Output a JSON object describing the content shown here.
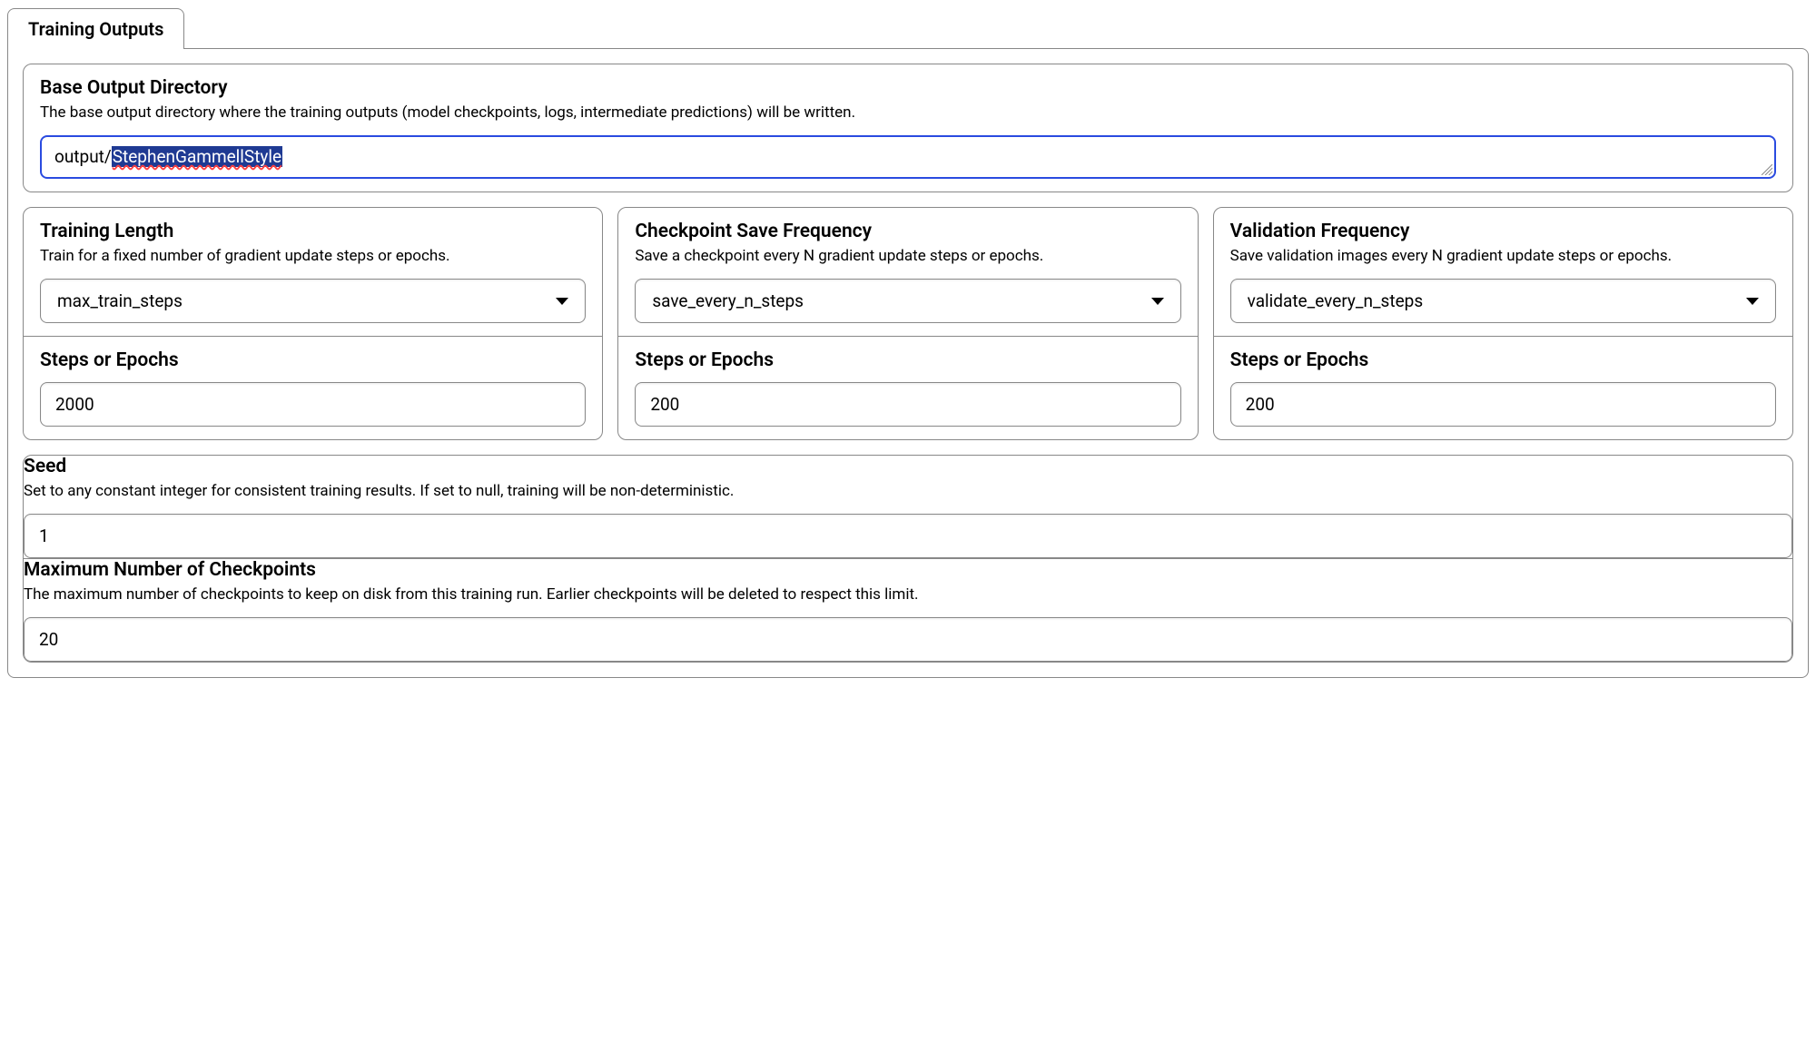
{
  "tab": {
    "label": "Training Outputs"
  },
  "base_output": {
    "title": "Base Output Directory",
    "desc": "The base output directory where the training outputs (model checkpoints, logs, intermediate predictions) will be written.",
    "value_prefix": "output/",
    "value_selected": "StephenGammellStyle"
  },
  "training_length": {
    "title": "Training Length",
    "desc": "Train for a fixed number of gradient update steps or epochs.",
    "select_value": "max_train_steps",
    "steps_label": "Steps or Epochs",
    "steps_value": "2000"
  },
  "checkpoint_freq": {
    "title": "Checkpoint Save Frequency",
    "desc": "Save a checkpoint every N gradient update steps or epochs.",
    "select_value": "save_every_n_steps",
    "steps_label": "Steps or Epochs",
    "steps_value": "200"
  },
  "validation_freq": {
    "title": "Validation Frequency",
    "desc": "Save validation images every N gradient update steps or epochs.",
    "select_value": "validate_every_n_steps",
    "steps_label": "Steps or Epochs",
    "steps_value": "200"
  },
  "seed": {
    "title": "Seed",
    "desc": "Set to any constant integer for consistent training results. If set to null, training will be non-deterministic.",
    "value": "1"
  },
  "max_checkpoints": {
    "title": "Maximum Number of Checkpoints",
    "desc": "The maximum number of checkpoints to keep on disk from this training run. Earlier checkpoints will be deleted to respect this limit.",
    "value": "20"
  }
}
